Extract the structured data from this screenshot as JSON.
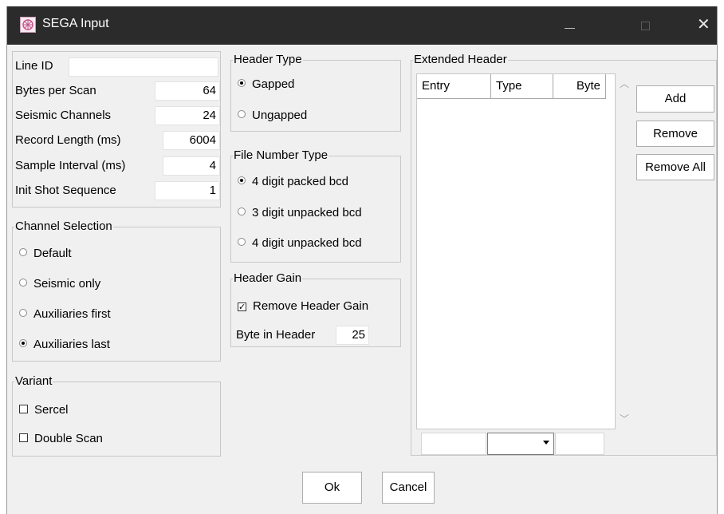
{
  "window": {
    "title": "SEGA Input",
    "icon": "sega-app-icon",
    "controls": {
      "minimize": "—",
      "maximize": "□",
      "close": "✕"
    }
  },
  "fields": [
    {
      "label": "Line ID",
      "value": ""
    },
    {
      "label": "Bytes per Scan",
      "value": "64"
    },
    {
      "label": "Seismic Channels",
      "value": "24"
    },
    {
      "label": "Record Length (ms)",
      "value": "6004"
    },
    {
      "label": "Sample Interval (ms)",
      "value": "4"
    },
    {
      "label": "Init Shot Sequence",
      "value": "1"
    }
  ],
  "channel_selection": {
    "title": "Channel Selection",
    "options": [
      "Default",
      "Seismic only",
      "Auxiliaries first",
      "Auxiliaries last"
    ],
    "selected": "Auxiliaries last"
  },
  "variant": {
    "title": "Variant",
    "options": [
      {
        "label": "Sercel",
        "checked": false
      },
      {
        "label": "Double Scan",
        "checked": false
      }
    ]
  },
  "header_type": {
    "title": "Header Type",
    "options": [
      "Gapped",
      "Ungapped"
    ],
    "selected": "Gapped"
  },
  "file_number_type": {
    "title": "File Number Type",
    "options": [
      "4 digit packed bcd",
      "3 digit unpacked bcd",
      "4 digit unpacked bcd"
    ],
    "selected": "4 digit packed bcd"
  },
  "header_gain": {
    "title": "Header Gain",
    "remove_label": "Remove Header Gain",
    "remove_checked": true,
    "byte_label": "Byte in Header",
    "byte_value": "25"
  },
  "extended_header": {
    "title": "Extended Header",
    "columns": [
      "Entry",
      "Type",
      "Byte"
    ],
    "rows": [],
    "new_entry": {
      "entry": "",
      "type": "",
      "byte": ""
    }
  },
  "buttons": {
    "add": "Add",
    "remove": "Remove",
    "remove_all": "Remove All",
    "ok": "Ok",
    "cancel": "Cancel"
  }
}
